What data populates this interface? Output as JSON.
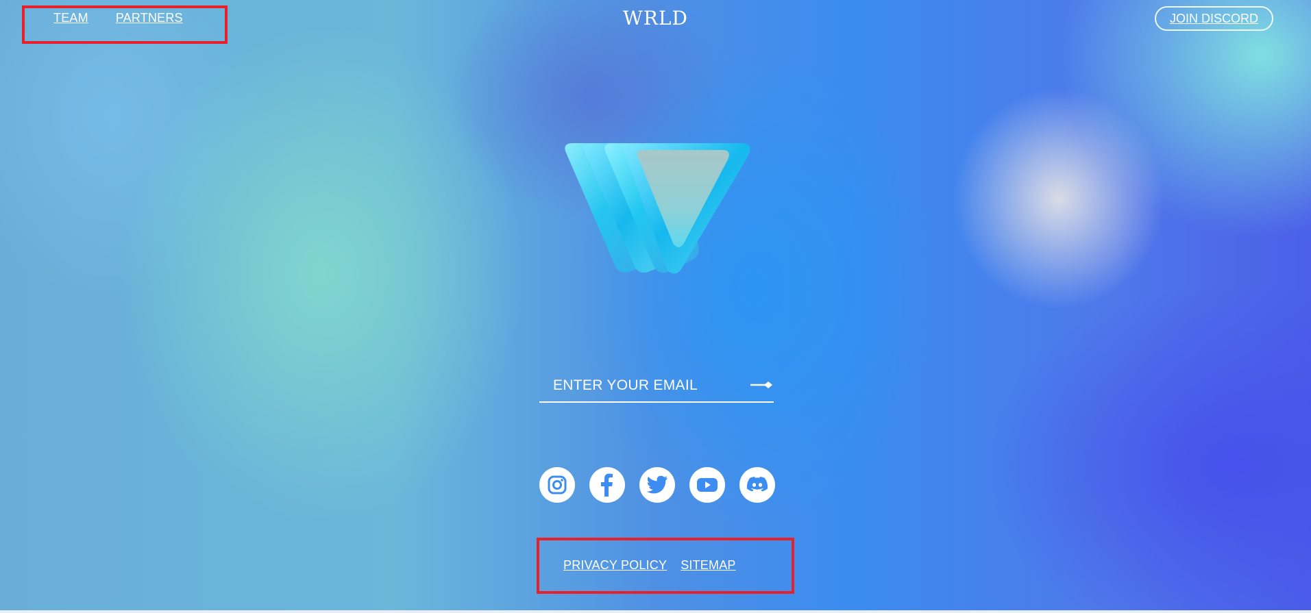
{
  "header": {
    "nav": [
      {
        "label": "TEAM"
      },
      {
        "label": "PARTNERS"
      }
    ],
    "logo_text": "WRLD",
    "join_label": "JOIN DISCORD"
  },
  "hero": {
    "logo_icon": "wrld-3d-logo"
  },
  "signup": {
    "email_placeholder": "ENTER YOUR EMAIL",
    "submit_icon": "arrow-right-icon"
  },
  "socials": [
    {
      "name": "instagram",
      "icon": "instagram-icon"
    },
    {
      "name": "facebook",
      "icon": "facebook-icon"
    },
    {
      "name": "twitter",
      "icon": "twitter-icon"
    },
    {
      "name": "youtube",
      "icon": "youtube-icon"
    },
    {
      "name": "discord",
      "icon": "discord-icon"
    }
  ],
  "footer": {
    "links": [
      {
        "label": "PRIVACY POLICY"
      },
      {
        "label": "SITEMAP"
      }
    ]
  },
  "colors": {
    "text": "#ffffff",
    "icon": "#3d8cf2",
    "highlight": "#e8202a"
  }
}
